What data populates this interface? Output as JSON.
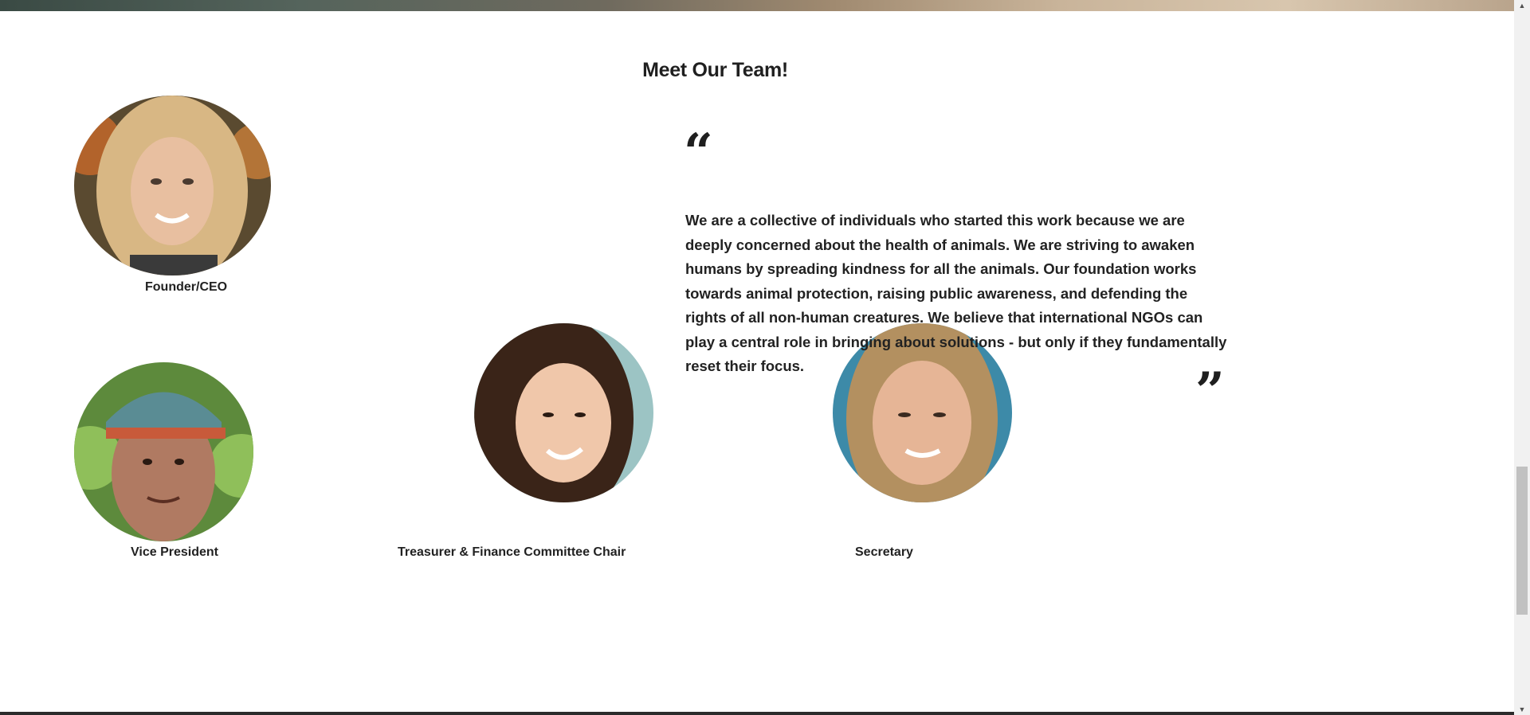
{
  "section": {
    "title": "Meet Our Team!"
  },
  "team": [
    {
      "role": "Founder/CEO",
      "photo_icon": "founder-photo"
    },
    {
      "role": "Vice President",
      "photo_icon": "vice-president-photo"
    },
    {
      "role": "Treasurer & Finance Committee Chair",
      "photo_icon": "treasurer-photo"
    },
    {
      "role": "Secretary",
      "photo_icon": "secretary-photo"
    }
  ],
  "quote": {
    "open_mark": "“",
    "close_mark": "”",
    "text": "We are a collective of individuals who started this work because we are deeply concerned about the health of animals. We are striving to awaken humans by spreading kindness for all the animals. Our foundation works towards animal protection, raising public awareness, and defending the rights of all non-human creatures. We believe that international NGOs can play a central role in bringing about solutions - but only if they fundamentally reset their focus."
  },
  "scrollbar": {
    "up_icon": "scroll-up-arrow-icon",
    "down_icon": "scroll-down-arrow-icon"
  }
}
